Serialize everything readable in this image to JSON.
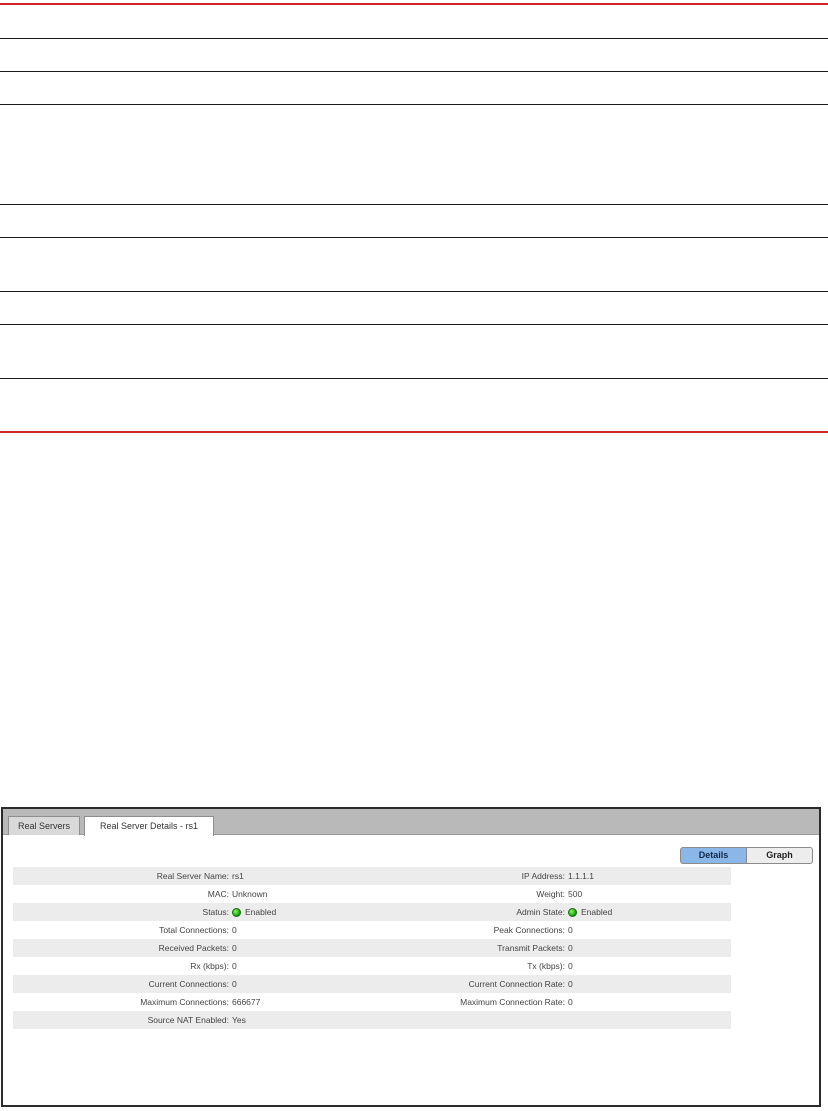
{
  "tabs": {
    "inactive_label": "Real Servers",
    "active_label": "Real Server Details - rs1"
  },
  "view_toggle": {
    "details_label": "Details",
    "graph_label": "Graph"
  },
  "fields": {
    "real_server_name": {
      "label": "Real Server Name:",
      "value": "rs1"
    },
    "ip_address": {
      "label": "IP Address:",
      "value": "1.1.1.1"
    },
    "mac": {
      "label": "MAC:",
      "value": "Unknown"
    },
    "weight": {
      "label": "Weight:",
      "value": "500"
    },
    "status": {
      "label": "Status:",
      "value": "Enabled"
    },
    "admin_state": {
      "label": "Admin State:",
      "value": "Enabled"
    },
    "total_connections": {
      "label": "Total Connections:",
      "value": "0"
    },
    "peak_connections": {
      "label": "Peak Connections:",
      "value": "0"
    },
    "received_packets": {
      "label": "Received Packets:",
      "value": "0"
    },
    "transmit_packets": {
      "label": "Transmit Packets:",
      "value": "0"
    },
    "rx_kbps": {
      "label": "Rx (kbps):",
      "value": "0"
    },
    "tx_kbps": {
      "label": "Tx (kbps):",
      "value": "0"
    },
    "current_connections": {
      "label": "Current Connections:",
      "value": "0"
    },
    "current_connection_rate": {
      "label": "Current Connection Rate:",
      "value": "0"
    },
    "maximum_connections": {
      "label": "Maximum Connections:",
      "value": "666677"
    },
    "maximum_connection_rate": {
      "label": "Maximum Connection Rate:",
      "value": "0"
    },
    "source_nat_enabled": {
      "label": "Source NAT Enabled:",
      "value": "Yes"
    }
  },
  "colors": {
    "rule_red": "#d2232a",
    "status_green": "#1a9a10",
    "details_active": "#8ab6e8"
  }
}
